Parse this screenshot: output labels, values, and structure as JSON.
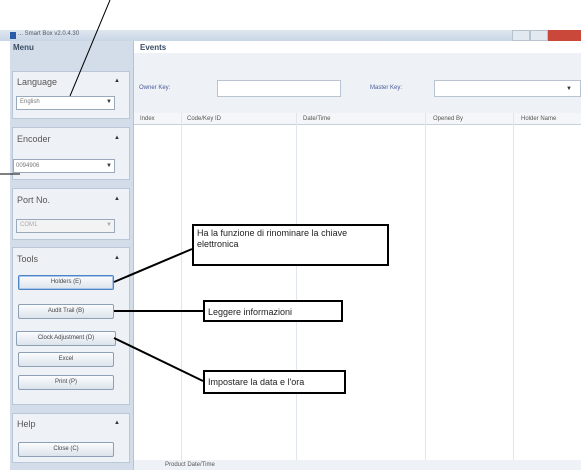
{
  "window": {
    "title": "... Smart Box v2.0.4.30"
  },
  "menu": {
    "title": "Menu",
    "language": {
      "label": "Language",
      "value": "English"
    },
    "encoder": {
      "label": "Encoder",
      "value": "0094906"
    },
    "port": {
      "label": "Port No.",
      "value": "COM1"
    },
    "tools": {
      "label": "Tools",
      "buttons": [
        "Holders (E)",
        "Audit Trail (B)",
        "Clock Adjustment (D)",
        "Excel",
        "Print (P)"
      ]
    },
    "help": {
      "label": "Help",
      "close": "Close (C)"
    }
  },
  "events": {
    "title": "Events",
    "owner_key_label": "Owner Key:",
    "master_key_label": "Master Key:",
    "columns": [
      "Index",
      "Code/Key ID",
      "Date/Time",
      "Opened By",
      "Holder Name"
    ]
  },
  "status": {
    "text": "Product Date/Time"
  },
  "callouts": {
    "holders": "Ha la funzione di rinominare la chiave elettronica",
    "audit": "Leggere informazioni",
    "clock": "Impostare la data e l'ora"
  }
}
